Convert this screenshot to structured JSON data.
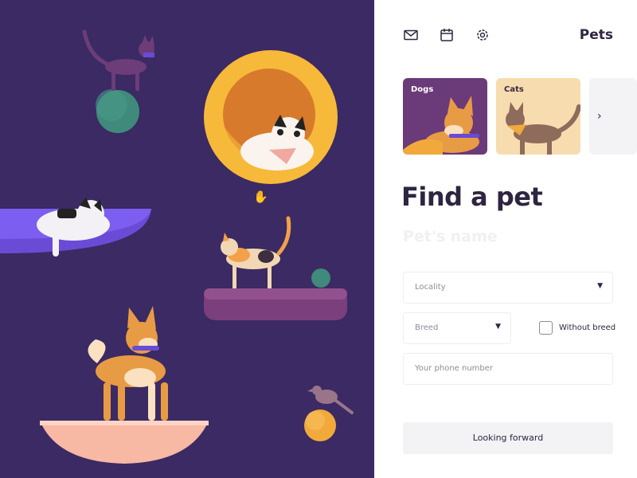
{
  "header": {
    "brand": "Pets",
    "icons": [
      "mail-icon",
      "calendar-icon",
      "gear-icon"
    ]
  },
  "categories": [
    {
      "label": "Dogs",
      "color": "#6b3a78"
    },
    {
      "label": "Cats",
      "color": "#f7dcaf"
    }
  ],
  "categories_next_icon": "chevron-right-icon",
  "form": {
    "heading": "Find a pet",
    "name_placeholder": "Pet's name",
    "locality_placeholder": "Locality",
    "breed_placeholder": "Breed",
    "without_breed_label": "Without breed",
    "phone_placeholder": "Your phone number",
    "submit_label": "Looking forward"
  },
  "colors": {
    "hero_background": "#3b2a63",
    "text": "#2e2540",
    "accent_orange": "#f2a93b",
    "accent_violet": "#6a4bd6"
  }
}
